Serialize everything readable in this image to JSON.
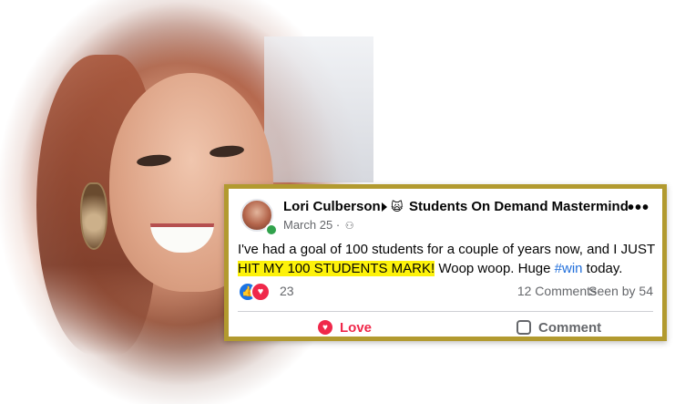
{
  "post": {
    "author": "Lori Culberson",
    "group_icon": "group-emoji-icon",
    "group": "Students On Demand Mastermind",
    "date": "March 25",
    "date_separator": "·",
    "text_before": "I've had a goal of 100 students for a couple of years now, and I JUST",
    "highlight": "HIT MY 100 STUDENTS MARK!",
    "text_after": " Woop woop. Huge ",
    "hashtag": "#win",
    "text_end": " today.",
    "reaction_count": "23",
    "comments": "12 Comments",
    "seen": "Seen by 54",
    "love_label": "Love",
    "comment_label": "Comment",
    "more_label": "•••"
  },
  "colors": {
    "border": "#b29a2f",
    "highlight": "#fdf20a",
    "love": "#f0284a",
    "like": "#1b74e4",
    "hashtag": "#216fdb"
  }
}
